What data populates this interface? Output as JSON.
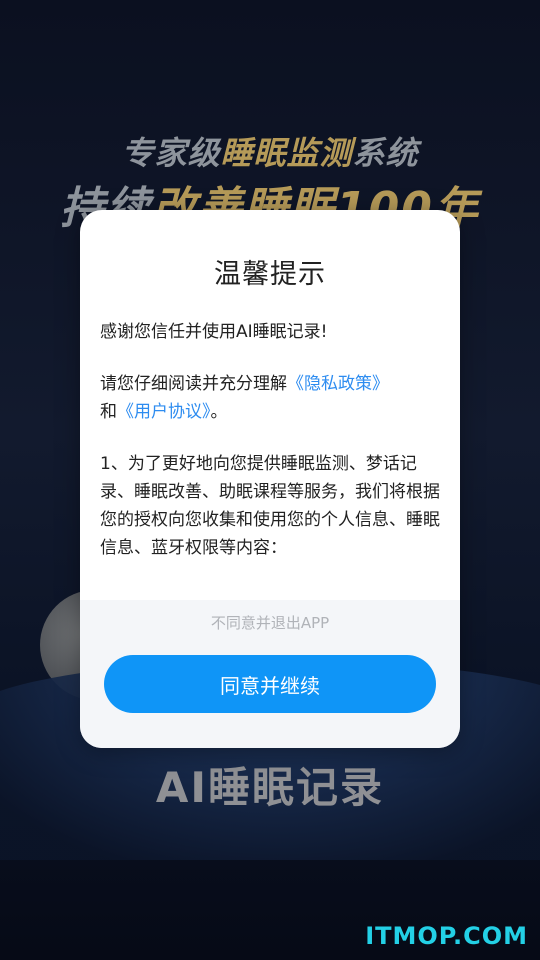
{
  "background": {
    "slogan_line1": {
      "part1": "专家级",
      "part2": "睡眠监测",
      "part3": "系统"
    },
    "slogan_line2": {
      "part1": "持续",
      "part2": "改善睡眠100年"
    },
    "app_name": "AI睡眠记录",
    "watermark": "ITMOP.COM"
  },
  "dialog": {
    "title": "温馨提示",
    "thanks": "感谢您信任并使用AI睡眠记录!",
    "read_prefix": "请您仔细阅读并充分理解",
    "privacy_link": "《隐私政策》",
    "and": "和",
    "agreement_link": "《用户协议》",
    "read_suffix": "。",
    "item1": "1、为了更好地向您提供睡眠监测、梦话记录、睡眠改善、助眠课程等服务，我们将根据您的授权向您收集和使用您的个人信息、睡眠信息、蓝牙权限等内容：",
    "decline_label": "不同意并退出APP",
    "agree_label": "同意并继续"
  },
  "colors": {
    "accent": "#0f95f7",
    "link": "#2d8cf0",
    "gold": "#b59a58"
  }
}
